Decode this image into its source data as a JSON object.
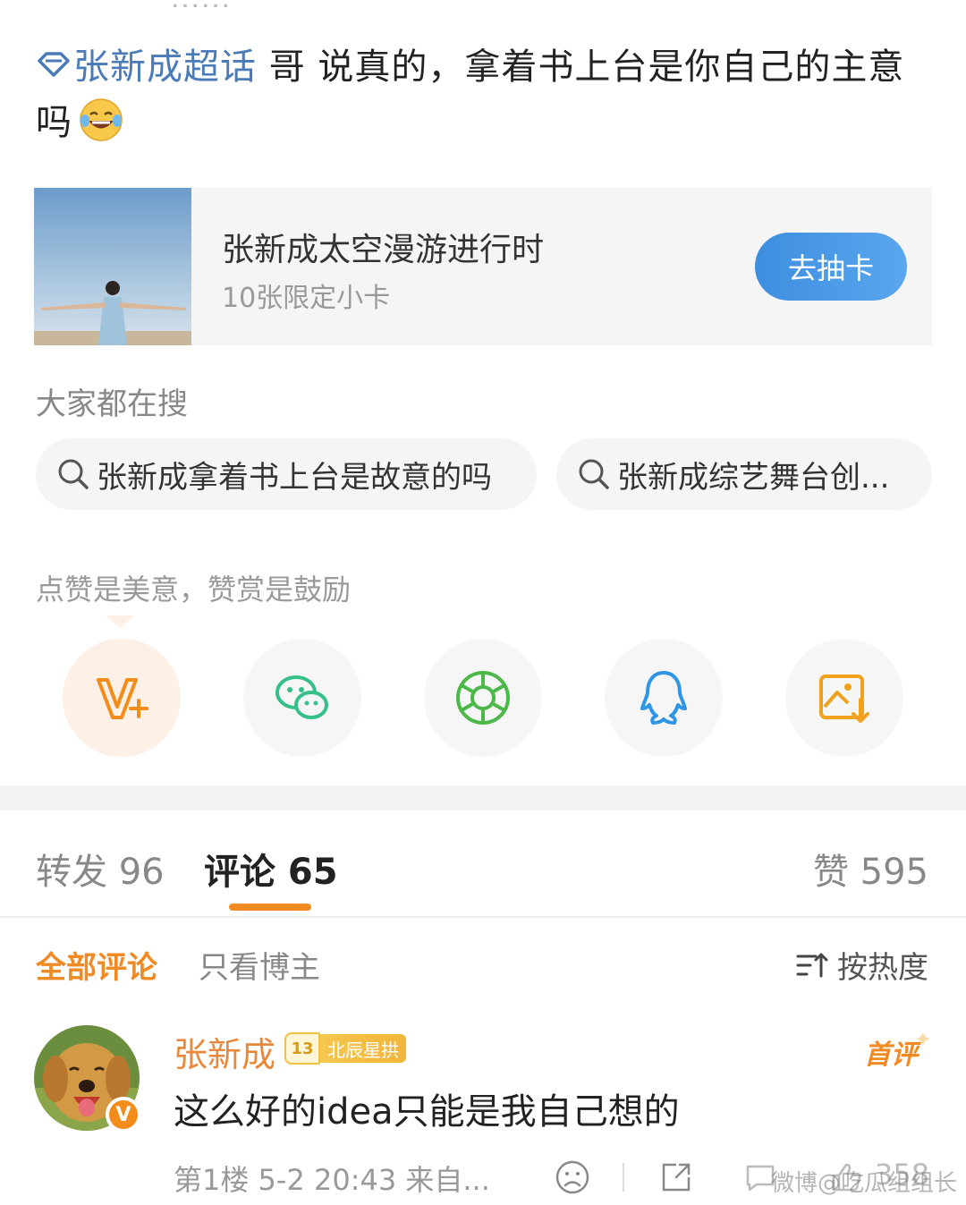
{
  "post": {
    "topic": "张新成超话",
    "text": " 哥 说真的，拿着书上台是你自己的主意吗",
    "emoji": "laughing-tears-emoji"
  },
  "card": {
    "title": "张新成太空漫游进行时",
    "subtitle": "10张限定小卡",
    "button": "去抽卡"
  },
  "search": {
    "title": "大家都在搜",
    "items": [
      "张新成拿着书上台是故意的吗",
      "张新成综艺舞台创..."
    ]
  },
  "reward": {
    "text": "点赞是美意，赞赏是鼓励",
    "share_icons": [
      "v-plus-icon",
      "wechat-icon",
      "moments-icon",
      "qq-icon",
      "save-image-icon"
    ]
  },
  "tabs": {
    "repost": "转发 96",
    "comment": "评论 65",
    "like": "赞 595"
  },
  "filters": {
    "all": "全部评论",
    "author_only": "只看博主",
    "sort": "按热度"
  },
  "comment": {
    "name": "张新成",
    "fan_level": "13",
    "fan_group": "北辰星拱",
    "first_label": "首评",
    "verified": "V",
    "text": "这么好的idea只能是我自己想的",
    "meta": "第1楼 5-2 20:43 来自...",
    "like_count": "358"
  },
  "watermark": "微博@吃瓜组组长",
  "colors": {
    "accent": "#f08a24",
    "link": "#4a7ab8",
    "button": "#4a9be8"
  }
}
